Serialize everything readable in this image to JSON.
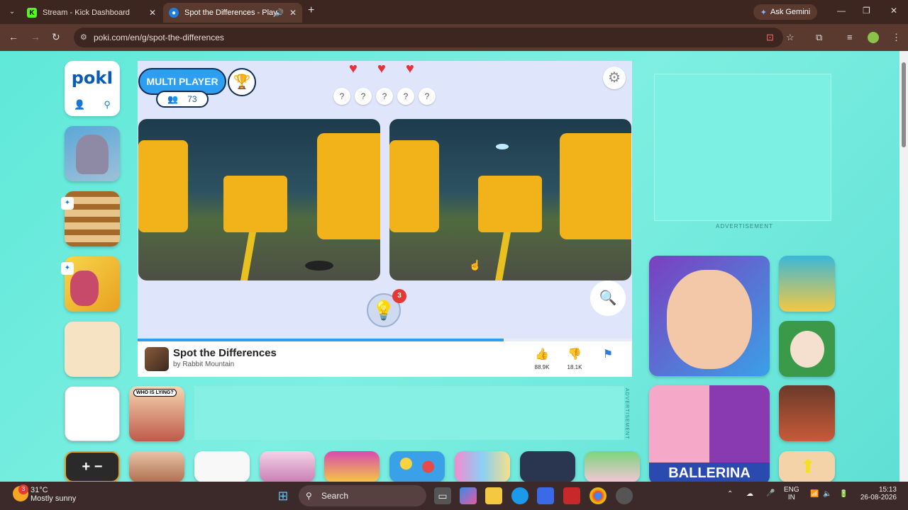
{
  "browser": {
    "tabs": [
      {
        "title": "Stream - Kick Dashboard",
        "icon": "kick-icon",
        "active": false
      },
      {
        "title": "Spot the Differences - Play",
        "icon": "poki-icon",
        "active": true
      }
    ],
    "ask_gemini": "Ask Gemini",
    "url": "poki.com/en/g/spot-the-differences"
  },
  "site": {
    "logo": "pokI"
  },
  "game": {
    "multiplayer_label": "MULTI PLAYER",
    "players_count": "73",
    "hearts": 3,
    "unknown_differences": [
      "?",
      "?",
      "?",
      "?",
      "?"
    ],
    "hint_count": "3",
    "progress": 0.74,
    "title": "Spot the Differences",
    "author": "by Rabbit Mountain",
    "likes": "88.9K",
    "dislikes": "18.1K"
  },
  "ads": {
    "label": "ADVERTISEMENT"
  },
  "tile_thumbnails": {
    "who_is_lying": "WHO IS LYING?",
    "ballerina": "BALLERINA",
    "calc_symbols": "+ −"
  },
  "taskbar": {
    "temperature": "31°C",
    "weather_text": "Mostly sunny",
    "weather_badge": "3",
    "search_label": "Search",
    "lang_top": "ENG",
    "lang_bottom": "IN",
    "time": "15:13",
    "date": "26-08-2026"
  },
  "colors": {
    "page_bg": "#5fe3d6",
    "accent_blue": "#2d9ef0",
    "heart_red": "#e8303a"
  }
}
